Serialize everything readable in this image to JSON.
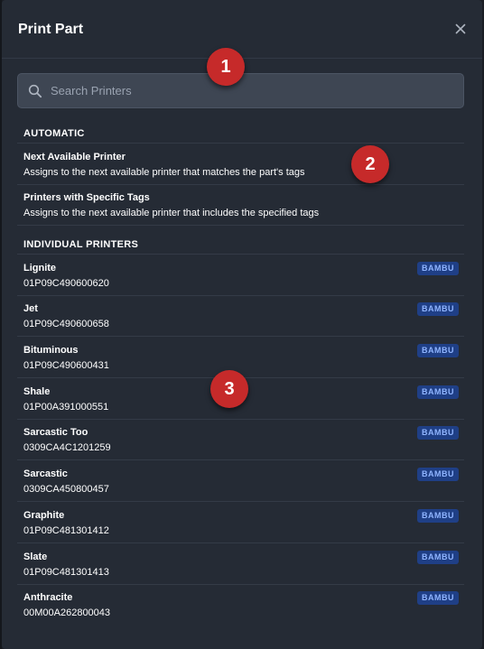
{
  "dialog": {
    "title": "Print Part",
    "close_icon": "close-icon"
  },
  "search": {
    "placeholder": "Search Printers",
    "value": "",
    "icon": "search-icon"
  },
  "automatic": {
    "heading": "AUTOMATIC",
    "items": [
      {
        "name": "Next Available Printer",
        "description": "Assigns to the next available printer that matches the part's tags"
      },
      {
        "name": "Printers with Specific Tags",
        "description": "Assigns to the next available printer that includes the specified tags"
      }
    ]
  },
  "individual": {
    "heading": "INDIVIDUAL PRINTERS",
    "printers": [
      {
        "name": "Lignite",
        "serial": "01P09C490600620",
        "badge": "BAMBU"
      },
      {
        "name": "Jet",
        "serial": "01P09C490600658",
        "badge": "BAMBU"
      },
      {
        "name": "Bituminous",
        "serial": "01P09C490600431",
        "badge": "BAMBU"
      },
      {
        "name": "Shale",
        "serial": "01P00A391000551",
        "badge": "BAMBU"
      },
      {
        "name": "Sarcastic Too",
        "serial": "0309CA4C1201259",
        "badge": "BAMBU"
      },
      {
        "name": "Sarcastic",
        "serial": "0309CA450800457",
        "badge": "BAMBU"
      },
      {
        "name": "Graphite",
        "serial": "01P09C481301412",
        "badge": "BAMBU"
      },
      {
        "name": "Slate",
        "serial": "01P09C481301413",
        "badge": "BAMBU"
      },
      {
        "name": "Anthracite",
        "serial": "00M00A262800043",
        "badge": "BAMBU"
      }
    ]
  },
  "markers": [
    "1",
    "2",
    "3"
  ],
  "colors": {
    "background": "#252b35",
    "badge_bg": "#1f3f86",
    "badge_text": "#8fb4ff",
    "marker": "#c62a2a"
  }
}
